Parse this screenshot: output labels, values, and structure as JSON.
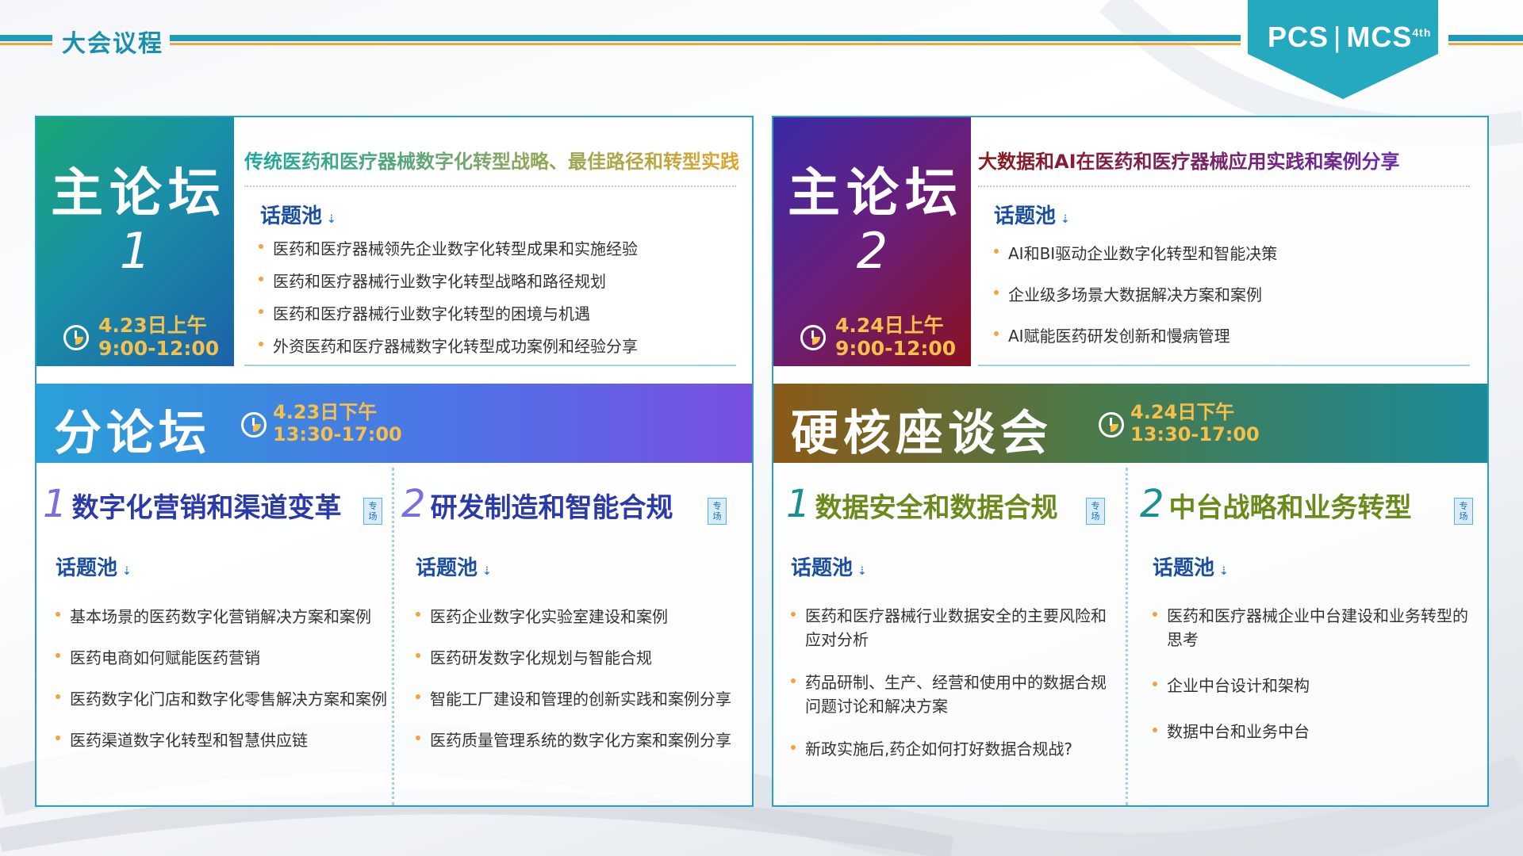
{
  "header": {
    "title": "大会议程",
    "logo_left": "PCS",
    "logo_right": "MCS",
    "logo_sup": "4th"
  },
  "colors": {
    "teal": "#1f9bb5",
    "orange": "#f2a33a",
    "gold": "#f7c04a",
    "blue": "#1a4fa0"
  },
  "main1": {
    "title": "主论坛",
    "number": "1",
    "date": "4.23日上午",
    "time": "9:00-12:00",
    "heading": "传统医药和医疗器械数字化转型战略、最佳路径和转型实践",
    "pool_label": "话题池",
    "items": [
      "医药和医疗器械领先企业数字化转型成果和实施经验",
      "医药和医疗器械行业数字化转型战略和路径规划",
      "医药和医疗器械行业数字化转型的困境与机遇",
      "外资医药和医疗器械数字化转型成功案例和经验分享"
    ]
  },
  "main2": {
    "title": "主论坛",
    "number": "2",
    "date": "4.24日上午",
    "time": "9:00-12:00",
    "heading": "大数据和AI在医药和医疗器械应用实践和案例分享",
    "pool_label": "话题池",
    "items": [
      "AI和BI驱动企业数字化转型和智能决策",
      "企业级多场景大数据解决方案和案例",
      "AI赋能医药研发创新和慢病管理"
    ]
  },
  "band1": {
    "title": "分论坛",
    "date": "4.23日下午",
    "time": "13:30-17:00"
  },
  "band2": {
    "title": "硬核座谈会",
    "date": "4.24日下午",
    "time": "13:30-17:00"
  },
  "tag_text": "专场",
  "sessions": [
    {
      "number": "1",
      "title": "数字化营销和渠道变革",
      "pool_label": "话题池",
      "items": [
        "基本场景的医药数字化营销解决方案和案例",
        "医药电商如何赋能医药营销",
        "医药数字化门店和数字化零售解决方案和案例",
        "医药渠道数字化转型和智慧供应链"
      ]
    },
    {
      "number": "2",
      "title": "研发制造和智能合规",
      "pool_label": "话题池",
      "items": [
        "医药企业数字化实验室建设和案例",
        "医药研发数字化规划与智能合规",
        "智能工厂建设和管理的创新实践和案例分享",
        "医药质量管理系统的数字化方案和案例分享"
      ]
    },
    {
      "number": "1",
      "title": "数据安全和数据合规",
      "pool_label": "话题池",
      "items": [
        "医药和医疗器械行业数据安全的主要风险和应对分析",
        "药品研制、生产、经营和使用中的数据合规问题讨论和解决方案",
        "新政实施后,药企如何打好数据合规战?"
      ]
    },
    {
      "number": "2",
      "title": "中台战略和业务转型",
      "pool_label": "话题池",
      "items": [
        "医药和医疗器械企业中台建设和业务转型的思考",
        "企业中台设计和架构",
        "数据中台和业务中台"
      ]
    }
  ]
}
